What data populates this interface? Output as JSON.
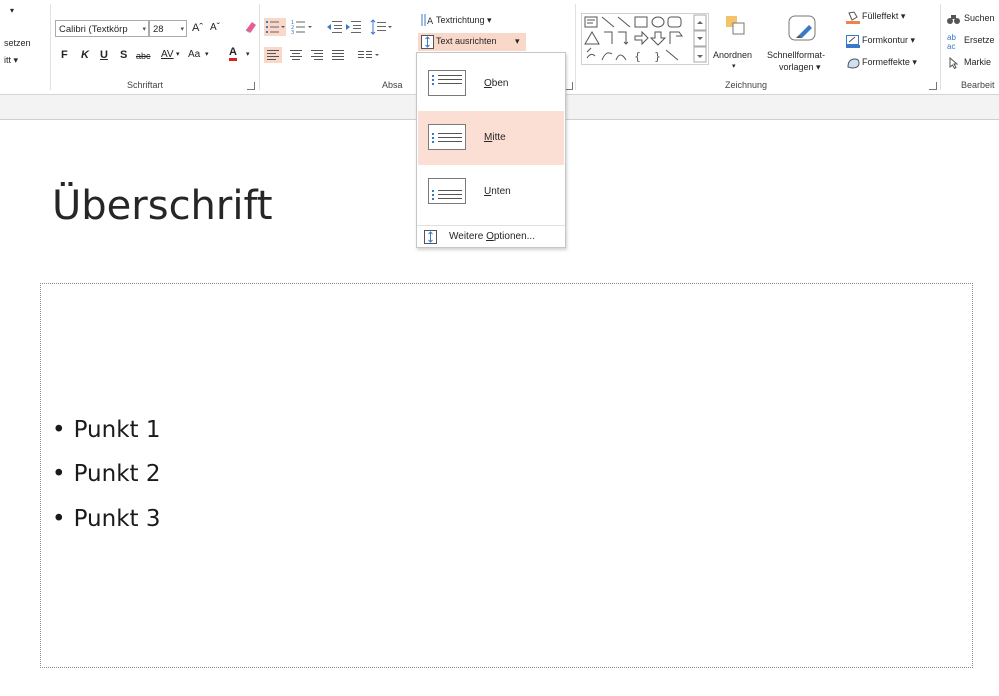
{
  "ribbon": {
    "clipboard": {
      "insert_label": "setzen",
      "section_label": "itt ▾"
    },
    "font": {
      "family_value": "Calibri (Textkörp",
      "size_value": "28",
      "grow_label": "Aˆ",
      "shrink_label": "Aˇ",
      "bold_label": "F",
      "italic_label": "K",
      "underline_label": "U",
      "shadow_label": "S",
      "strike_label": "abc",
      "spacing_label": "AV",
      "case_label": "Aa",
      "color_label": "A",
      "group_label": "Schriftart"
    },
    "paragraph": {
      "group_label": "Absa",
      "text_direction_label": "Textrichtung",
      "align_text_label": "Text ausrichten"
    },
    "drawing": {
      "arrange_label": "Anordnen",
      "quick_styles_label_1": "Schnellformat-",
      "quick_styles_label_2": "vorlagen",
      "fill_label": "Fülleffekt",
      "outline_label": "Formkontur",
      "effects_label": "Formeffekte",
      "group_label": "Zeichnung"
    },
    "editing": {
      "find_label": "Suchen",
      "replace_label": "Ersetze",
      "select_label": "Markie",
      "group_label": "Bearbeit"
    }
  },
  "dropdown": {
    "items": [
      {
        "label": "Oben",
        "accel": "O",
        "rest": "ben",
        "active": false
      },
      {
        "label": "Mitte",
        "accel": "M",
        "rest": "itte",
        "active": true
      },
      {
        "label": "Unten",
        "accel": "U",
        "rest": "nten",
        "active": false
      }
    ],
    "more_prefix": "Weitere ",
    "more_accel": "O",
    "more_rest": "ptionen..."
  },
  "slide": {
    "title": "Überschrift",
    "bullets": [
      "Punkt 1",
      "Punkt 2",
      "Punkt 3"
    ],
    "bullet_char": "•"
  },
  "colors": {
    "accent_highlight": "#f9d7c9",
    "dropdown_active": "#fcdfd4",
    "font_color_underline": "#e02020"
  },
  "icons": [
    "paste-arrow-icon",
    "clear-format-icon",
    "bullets-icon",
    "numbering-icon",
    "decrease-indent-icon",
    "increase-indent-icon",
    "line-spacing-icon",
    "text-direction-icon",
    "align-text-icon",
    "align-left-icon",
    "align-center-icon",
    "align-right-icon",
    "justify-icon",
    "columns-icon",
    "shapes-gallery-icon",
    "arrange-icon",
    "quick-styles-icon",
    "fill-icon",
    "outline-icon",
    "effects-icon",
    "find-icon",
    "replace-icon",
    "select-icon"
  ]
}
